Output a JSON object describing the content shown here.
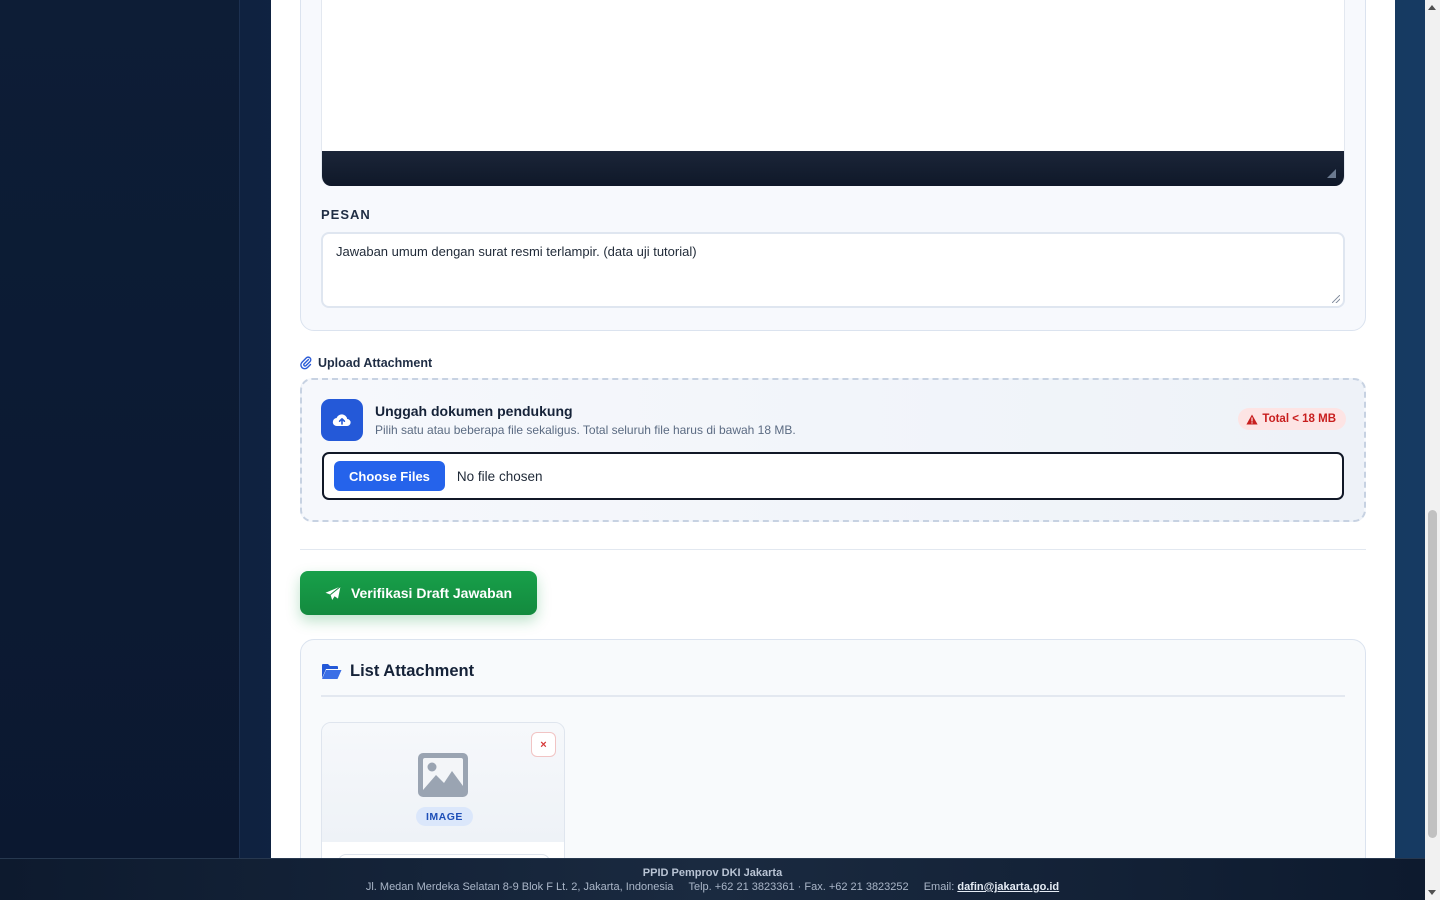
{
  "form": {
    "pesan_label": "PESAN",
    "pesan_value": "Jawaban umum dengan surat resmi terlampir. (data uji tutorial)"
  },
  "upload": {
    "section_title": "Upload Attachment",
    "heading": "Unggah dokumen pendukung",
    "subtext": "Pilih satu atau beberapa file sekaligus. Total seluruh file harus di bawah 18 MB.",
    "limit_badge": "Total < 18 MB",
    "choose_button": "Choose Files",
    "no_file_text": "No file chosen"
  },
  "actions": {
    "verify_button": "Verifikasi Draft Jawaban"
  },
  "attachments": {
    "title": "List Attachment",
    "items": [
      {
        "type_label": "IMAGE",
        "remove_label": "×"
      }
    ]
  },
  "footer": {
    "org": "PPID Pemprov DKI Jakarta",
    "address": "Jl. Medan Merdeka Selatan 8-9 Blok F Lt. 2, Jakarta, Indonesia",
    "phone": "Telp. +62 21 3823361 · Fax. +62 21 3823252",
    "email_label": "Email:",
    "email": "dafin@jakarta.go.id"
  },
  "colors": {
    "primary": "#2563eb",
    "success": "#16a34a",
    "danger": "#c81e1e",
    "sidebar": "#0d1d36"
  },
  "icons": {
    "upload": "cloud-upload-icon",
    "attachment": "paperclip-icon",
    "send": "paper-plane-icon",
    "folder": "folder-open-icon",
    "image": "image-icon",
    "warning": "warning-icon"
  }
}
